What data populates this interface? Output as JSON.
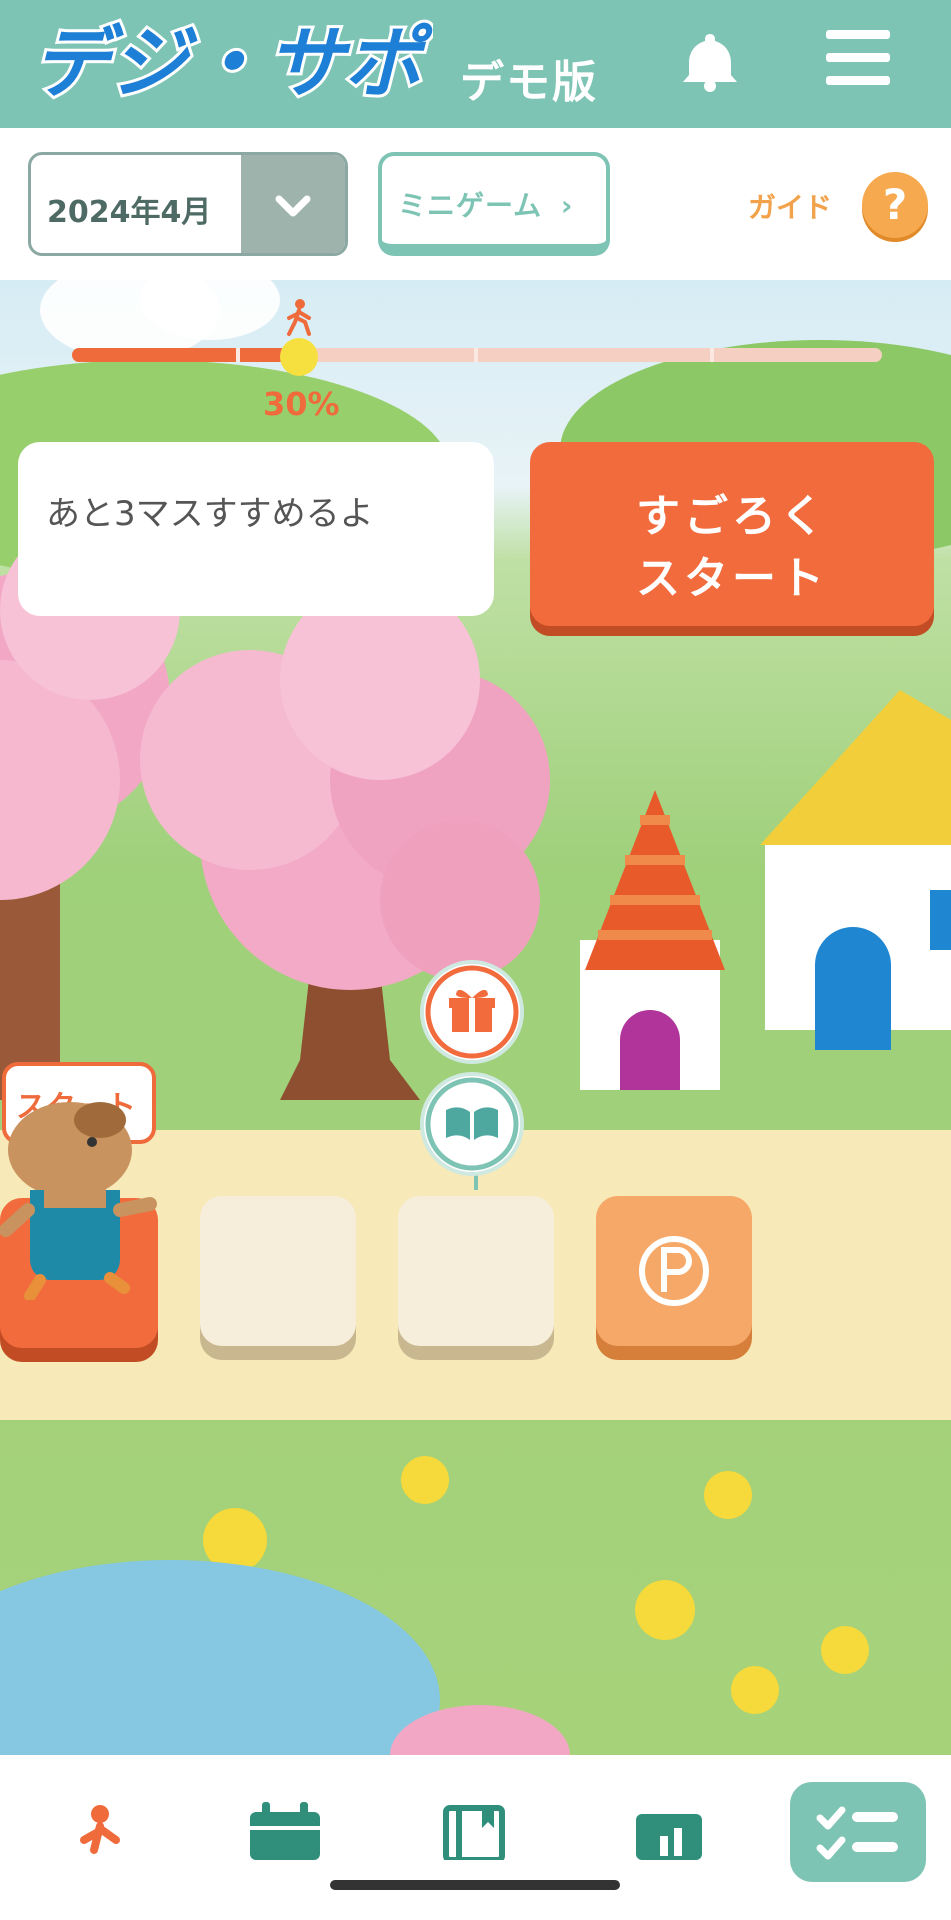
{
  "header": {
    "logo_text": "デジ・サポ",
    "edition_label": "デモ版",
    "bell_icon": "bell-icon",
    "menu_icon": "hamburger-menu-icon",
    "background_color": "#7ec4b4"
  },
  "controls": {
    "month_select_value": "2024年4月",
    "minigame_label": "ミニゲーム",
    "guide_label": "ガイド",
    "guide_icon_text": "?"
  },
  "progress": {
    "percent_label": "30%",
    "fraction": 0.28,
    "segments": 4,
    "fill_color": "#ef6b3c",
    "track_color": "#f4cfc2"
  },
  "message": {
    "text": "あと3マスすすめるよ"
  },
  "start_button": {
    "line1": "すごろく",
    "line2": "スタート",
    "color": "#f26b3d"
  },
  "board": {
    "start_tile_label": "スタート",
    "tiles": [
      "start",
      "blank",
      "blank",
      "point"
    ],
    "bubbles": [
      "gift-icon",
      "book-icon"
    ]
  },
  "bottom_nav": {
    "items": [
      "walk-icon",
      "calendar-icon",
      "book-icon",
      "chart-icon",
      "checklist-icon"
    ],
    "active_index": 4
  }
}
